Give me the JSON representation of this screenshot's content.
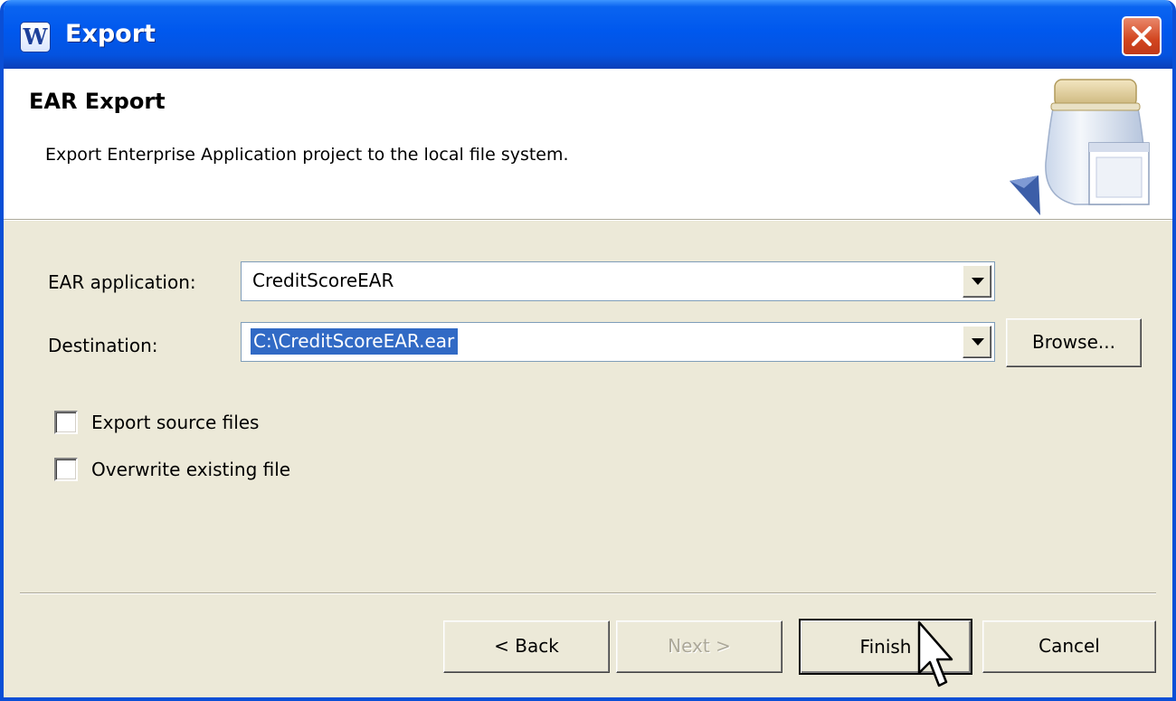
{
  "window": {
    "title": "Export",
    "app_icon_glyph": "W",
    "close_icon": "close-x-icon"
  },
  "banner": {
    "title": "EAR Export",
    "description": "Export Enterprise Application project to the local file system.",
    "graphic_icon": "jar-export-wizard-icon"
  },
  "form": {
    "ear_application": {
      "label": "EAR application:",
      "value": "CreditScoreEAR"
    },
    "destination": {
      "label": "Destination:",
      "value": "C:\\CreditScoreEAR.ear",
      "browse_label": "Browse..."
    },
    "options": [
      {
        "label": "Export source files",
        "checked": false
      },
      {
        "label": "Overwrite existing file",
        "checked": false
      }
    ]
  },
  "buttons": {
    "back": "< Back",
    "next": "Next >",
    "finish": "Finish",
    "cancel": "Cancel"
  },
  "colors": {
    "titlebar": "#0058ee",
    "selection": "#316ac5",
    "dialog_bg": "#ece9d8"
  }
}
